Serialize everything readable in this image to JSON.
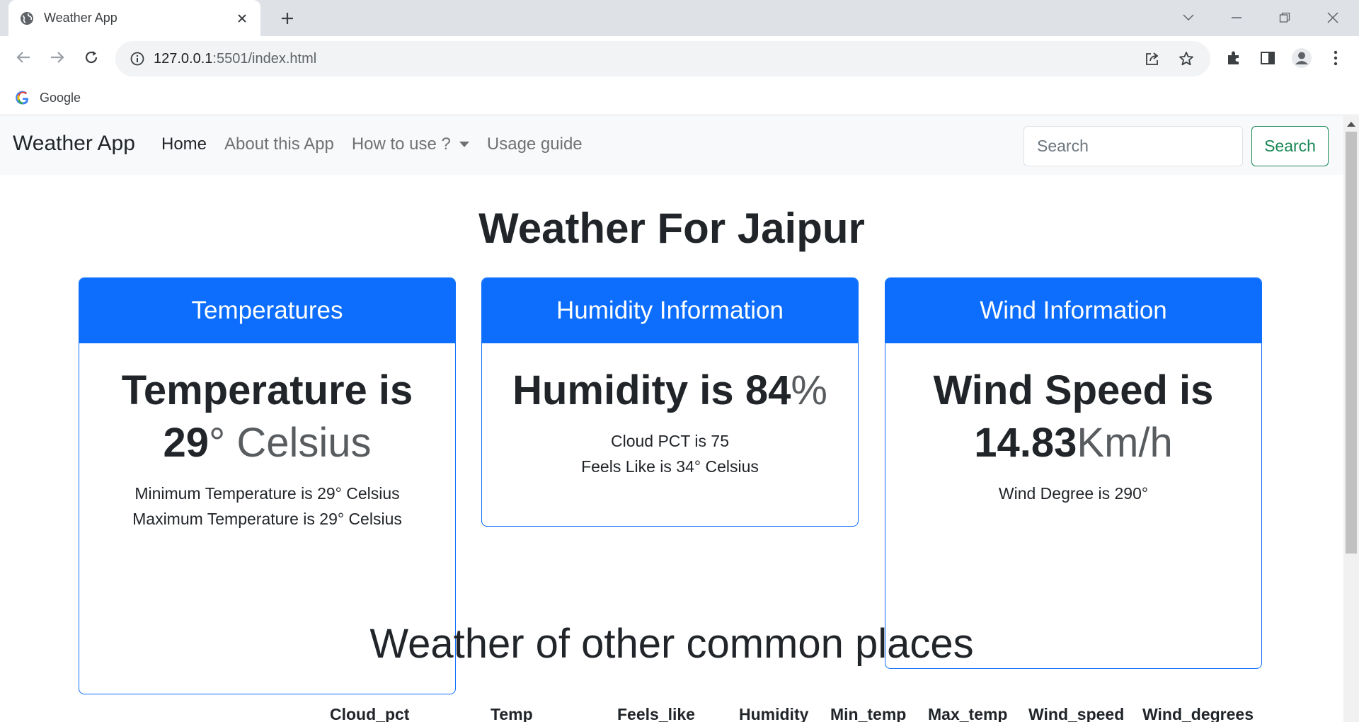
{
  "browser": {
    "tab_title": "Weather App",
    "url_host": "127.0.0.1",
    "url_path": ":5501/index.html",
    "bookmark_label": "Google"
  },
  "navbar": {
    "brand": "Weather App",
    "links": [
      {
        "label": "Home",
        "active": true
      },
      {
        "label": "About this App",
        "active": false
      },
      {
        "label": "How to use ?",
        "active": false,
        "dropdown": true
      },
      {
        "label": "Usage guide",
        "active": false
      }
    ],
    "search_placeholder": "Search",
    "search_button": "Search"
  },
  "page": {
    "heading": "Weather For Jaipur"
  },
  "cards": {
    "temperatures": {
      "header": "Temperatures",
      "big_prefix": "Temperature is",
      "big_value": "29",
      "big_unit": "° Celsius",
      "lines": [
        "Minimum Temperature is 29° Celsius",
        "Maximum Temperature is 29° Celsius"
      ]
    },
    "humidity": {
      "header": "Humidity Information",
      "big_prefix": "Humidity is",
      "big_value": "84",
      "big_unit": "%",
      "lines": [
        "Cloud PCT is 75",
        "Feels Like is 34° Celsius"
      ]
    },
    "wind": {
      "header": "Wind Information",
      "big_prefix": "Wind Speed is",
      "big_value": "14.83",
      "big_unit": "Km/h",
      "lines": [
        "Wind Degree is 290°"
      ]
    }
  },
  "other_places": {
    "heading": "Weather of other common places",
    "columns": [
      "Cloud_pct",
      "Temp",
      "Feels_like",
      "Humidity",
      "Min_temp",
      "Max_temp",
      "Wind_speed",
      "Wind_degrees"
    ]
  },
  "colors": {
    "primary": "#0d6efd",
    "success": "#198754",
    "navbar_bg": "#f8f9fa"
  }
}
